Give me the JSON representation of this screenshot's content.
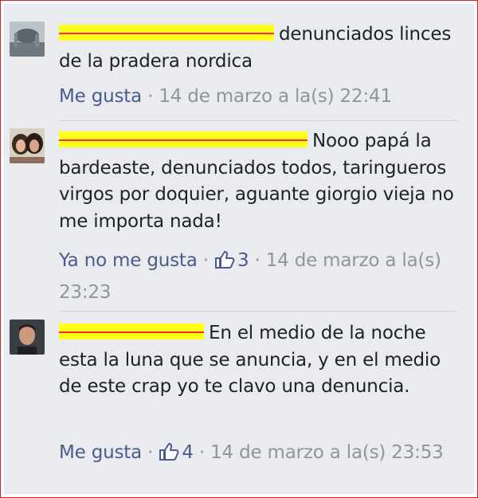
{
  "comments": [
    {
      "text": "denunciados linces de la pradera nordica",
      "like_label": "Me gusta",
      "separator": " · ",
      "time": "14 de marzo a la(s) 22:41",
      "likes": ""
    },
    {
      "text": "Nooo papá la bardeaste, denunciados todos, taringueros virgos por doquier, aguante giorgio vieja no me importa nada!",
      "like_label": "Ya no me gusta",
      "separator": " · ",
      "likes": "3",
      "time": "14 de marzo a la(s) 23:23"
    },
    {
      "text": "En el medio de la noche esta la luna que se anuncia, y en el medio de este crap yo te clavo una denuncia.",
      "like_label": "Me gusta",
      "separator": " · ",
      "likes": "4",
      "time": "14 de marzo a la(s) 23:53"
    }
  ],
  "colors": {
    "redaction": "#ffff1a",
    "redaction_strike": "#ff2a2a",
    "like_link": "#4b5b8e",
    "meta_text": "#90949c",
    "frame": "#e21b1b"
  }
}
